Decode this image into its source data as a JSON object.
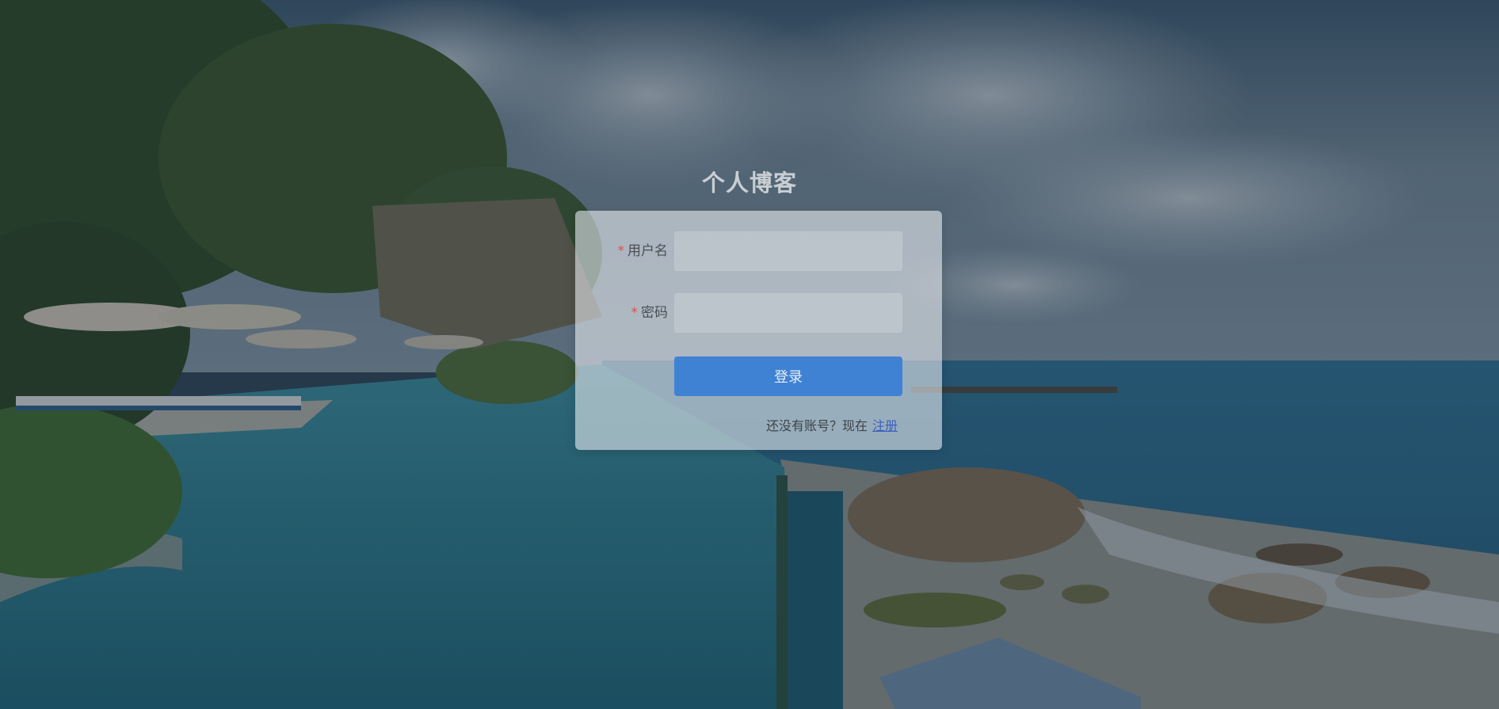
{
  "site": {
    "title": "个人博客"
  },
  "login_form": {
    "username": {
      "required_mark": "*",
      "label": "用户名",
      "value": "",
      "placeholder": ""
    },
    "password": {
      "required_mark": "*",
      "label": "密码",
      "value": "",
      "placeholder": ""
    },
    "submit_label": "登录",
    "signup_prompt": "还没有账号？现在",
    "signup_link": "注册"
  },
  "colors": {
    "primary_button": "#3f82d4",
    "required_mark": "#d9534f",
    "link": "#3a5fbf"
  }
}
